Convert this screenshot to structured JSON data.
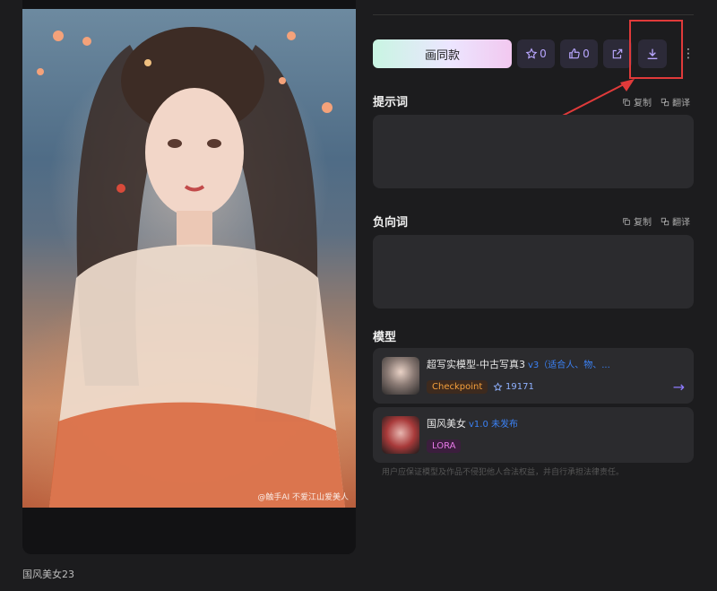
{
  "image": {
    "credit_text": "@触手AI 不爱江山爱美人",
    "caption": "国风美女23"
  },
  "actions": {
    "draw_same_label": "画同款",
    "star_count": "0",
    "like_count": "0",
    "more_label": "⋮"
  },
  "prompt": {
    "title": "提示词",
    "copy_label": "复制",
    "translate_label": "翻译"
  },
  "negative_prompt": {
    "title": "负向词",
    "copy_label": "复制",
    "translate_label": "翻译"
  },
  "models": {
    "title": "模型",
    "items": [
      {
        "name": "超写实模型-中古写真3",
        "version": "v3（适合人、物、...",
        "badge": "Checkpoint",
        "stars": "19171",
        "arrow": "→"
      },
      {
        "name": "国风美女",
        "version": "v1.0 未发布",
        "badge": "LORA"
      }
    ]
  },
  "disclaimer": "用户应保证模型及作品不侵犯他人合法权益，并自行承担法律责任。",
  "colors": {
    "accent": "#8e7bff",
    "highlight": "#e03a3a",
    "checkpoint": "#f5a03c",
    "lora": "#e879e8"
  }
}
